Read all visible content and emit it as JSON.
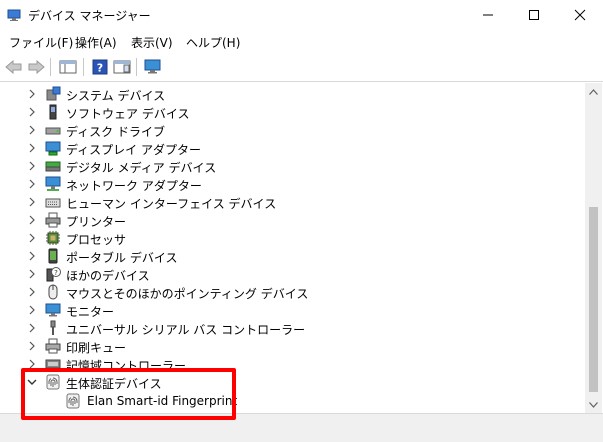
{
  "window": {
    "title": "デバイス マネージャー"
  },
  "menu": [
    "ファイル(F)",
    "操作(A)",
    "表示(V)",
    "ヘルプ(H)"
  ],
  "tree": {
    "categories": [
      "システム デバイス",
      "ソフトウェア デバイス",
      "ディスク ドライブ",
      "ディスプレイ アダプター",
      "デジタル メディア デバイス",
      "ネットワーク アダプター",
      "ヒューマン インターフェイス デバイス",
      "プリンター",
      "プロセッサ",
      "ポータブル デバイス",
      "ほかのデバイス",
      "マウスとそのほかのポインティング デバイス",
      "モニター",
      "ユニバーサル シリアル バス コントローラー",
      "印刷キュー",
      "記憶域コントローラー"
    ],
    "expanded": {
      "label": "生体認証デバイス",
      "children": [
        "Elan Smart-id Fingerprint"
      ]
    }
  },
  "colors": {
    "highlight": "#ff0000"
  }
}
